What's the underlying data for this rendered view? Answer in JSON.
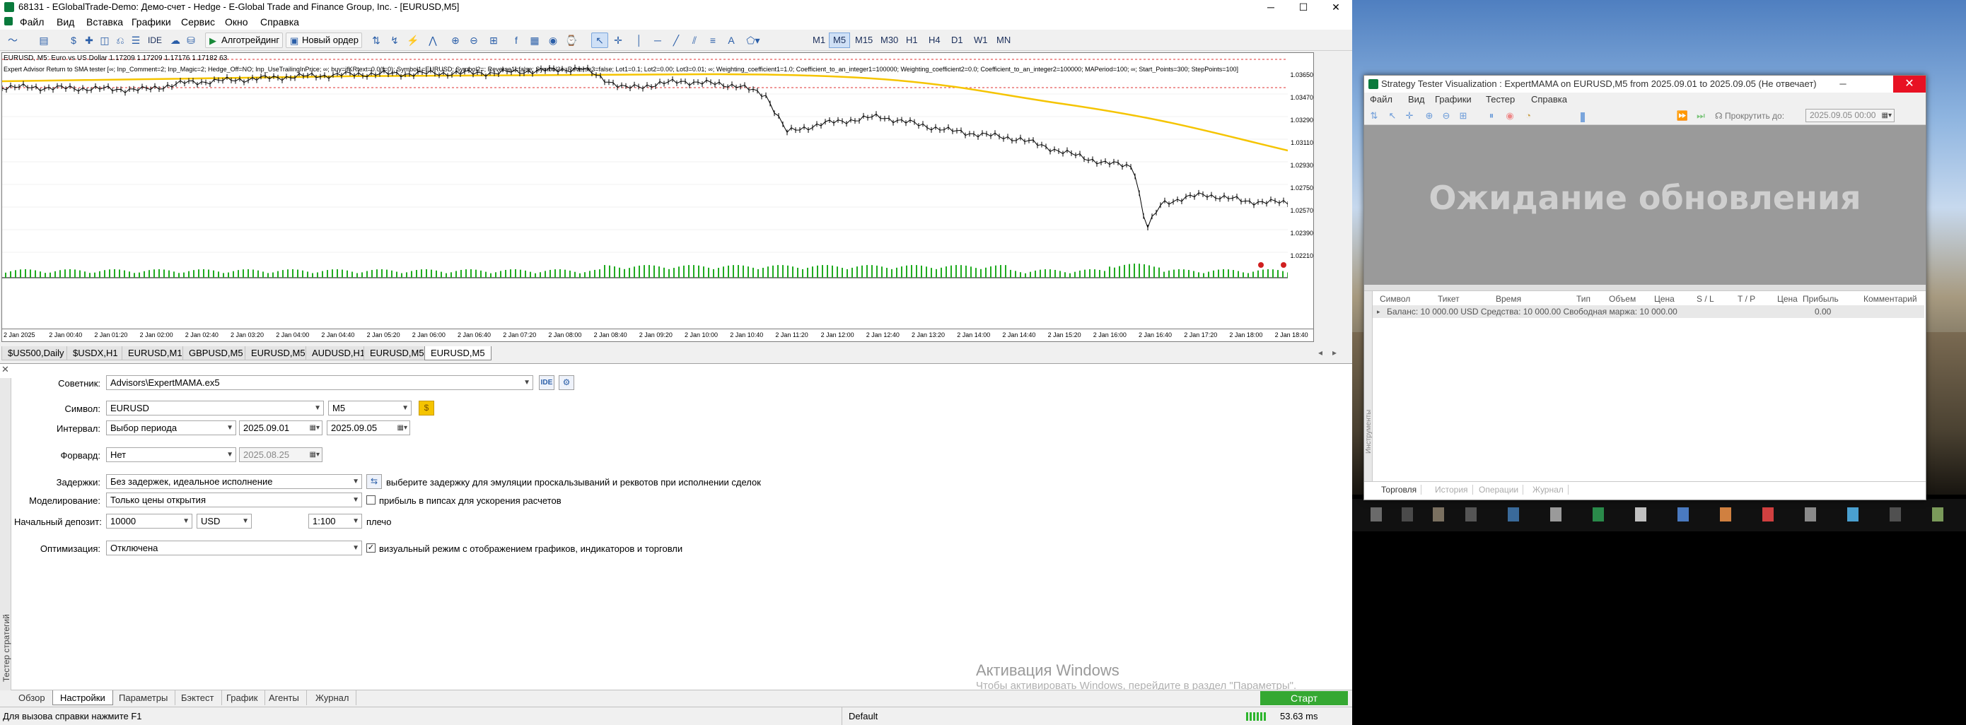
{
  "window": {
    "title": "68131 - EGlobalTrade-Demo: Демо-счет - Hedge - E-Global Trade and Finance Group, Inc. - [EURUSD,M5]",
    "minimize": "─",
    "maximize": "☐",
    "close": "✕"
  },
  "menu": [
    "Файл",
    "Вид",
    "Вставка",
    "Графики",
    "Сервис",
    "Окно",
    "Справка"
  ],
  "toolbar": {
    "ide": "IDE",
    "algotrading": "Алготрейдинг",
    "new_order": "Новый ордер",
    "timeframes": [
      "M1",
      "M5",
      "M15",
      "M30",
      "H1",
      "H4",
      "D1",
      "W1",
      "MN"
    ],
    "active_timeframe": "M5"
  },
  "chart": {
    "caption": "EURUSD, M5:  Euro vs US Dollar  1.17209 1.17209 1.17176 1.17182  63",
    "ea_line": "Expert Advisor Return to SMA tester [∞; Inp_Comment=2; Inp_Magic=2; Hedge_Off=NO; Inp_UseTrailingInPrice; ∞; buy=ifKRtext=0.0(f=0); Symbol1=EURUSD; Symbol2=; Reverse1=false; Symbol3=; Reverse3=false; Lot1=0.1; Lot2=0.00; Lot3=0.01; ∞; Weighting_coefficient1=1.0; Coefficient_to_an_integer1=100000; Weighting_coefficient2=0.0; Coefficient_to_an_integer2=100000; MAPeriod=100; ∞; Start_Points=300; StepPoints=100]",
    "y_ticks": [
      "1.03650",
      "1.03470",
      "1.03290",
      "1.03110",
      "1.02930",
      "1.02750",
      "1.02570",
      "1.02390",
      "1.02210"
    ],
    "x_ticks": [
      "2 Jan 2025",
      "2 Jan 00:40",
      "2 Jan 01:20",
      "2 Jan 02:00",
      "2 Jan 02:40",
      "2 Jan 03:20",
      "2 Jan 04:00",
      "2 Jan 04:40",
      "2 Jan 05:20",
      "2 Jan 06:00",
      "2 Jan 06:40",
      "2 Jan 07:20",
      "2 Jan 08:00",
      "2 Jan 08:40",
      "2 Jan 09:20",
      "2 Jan 10:00",
      "2 Jan 10:40",
      "2 Jan 11:20",
      "2 Jan 12:00",
      "2 Jan 12:40",
      "2 Jan 13:20",
      "2 Jan 14:00",
      "2 Jan 14:40",
      "2 Jan 15:20",
      "2 Jan 16:00",
      "2 Jan 16:40",
      "2 Jan 17:20",
      "2 Jan 18:00",
      "2 Jan 18:40"
    ],
    "colors": {
      "price": "#000000",
      "ma": "#f5c400",
      "levels": "#e03030",
      "volume": "#1faa1f"
    }
  },
  "chart_tabs": [
    "$US500,Daily",
    "$USDX,H1",
    "EURUSD,M1",
    "GBPUSD,M5",
    "EURUSD,M5",
    "AUDUSD,H1",
    "EURUSD,M5",
    "EURUSD,M5"
  ],
  "active_chart_tab": 7,
  "tester": {
    "side_title": "Тестер стратегий",
    "advisor_label": "Советник:",
    "advisor_value": "Advisors\\ExpertMAMA.ex5",
    "symbol_label": "Символ:",
    "symbol_value": "EURUSD",
    "period_value": "M5",
    "interval_label": "Интервал:",
    "interval_value": "Выбор периода",
    "date_from": "2025.09.01",
    "date_to": "2025.09.05",
    "forward_label": "Форвард:",
    "forward_value": "Нет",
    "forward_date": "2025.08.25",
    "delays_label": "Задержки:",
    "delays_value": "Без задержек, идеальное исполнение",
    "delays_note": "выберите задержку для эмуляции проскальзываний и реквотов при исполнении сделок",
    "modeling_label": "Моделирование:",
    "modeling_value": "Только цены открытия",
    "modeling_note": "прибыль в пипсах для ускорения расчетов",
    "deposit_label": "Начальный депозит:",
    "deposit_value": "10000",
    "currency_value": "USD",
    "leverage_value": "1:100",
    "leverage_note": "плечо",
    "optimization_label": "Оптимизация:",
    "optimization_value": "Отключена",
    "visual_note": "визуальный режим с отображением графиков, индикаторов и торговли",
    "tabs": [
      "Обзор",
      "Настройки",
      "Параметры",
      "Бэктест",
      "График",
      "Агенты",
      "Журнал"
    ],
    "active_tab": 1,
    "start": "Старт"
  },
  "watermark": {
    "line1": "Активация Windows",
    "line2": "Чтобы активировать Windows, перейдите в раздел \"Параметры\"."
  },
  "statusbar": {
    "help": "Для вызова справки нажмите F1",
    "profile": "Default",
    "ping": "53.63 ms"
  },
  "stv": {
    "title": "Strategy Tester Visualization : ExpertMAMA on EURUSD,M5 from 2025.09.01 to 2025.09.05 (Не отвечает)",
    "close": "✕",
    "menu": [
      "Файл",
      "Вид",
      "Графики",
      "Тестер",
      "Справка"
    ],
    "scroll_label": "Прокрутить до:",
    "scroll_value": "2025.09.05 00:00",
    "waiting": "Ожидание обновления",
    "columns": [
      "Символ",
      "Тикет",
      "Время",
      "Тип",
      "Объем",
      "Цена",
      "S / L",
      "T / P",
      "Цена",
      "Прибыль",
      "Комментарий"
    ],
    "balance": "Баланс: 10 000.00 USD  Средства: 10 000.00  Свободная маржа: 10 000.00",
    "balance_profit": "0.00",
    "side_label": "Инструменты",
    "tabs": [
      "Торговля",
      "История",
      "Операции",
      "Журнал"
    ]
  }
}
